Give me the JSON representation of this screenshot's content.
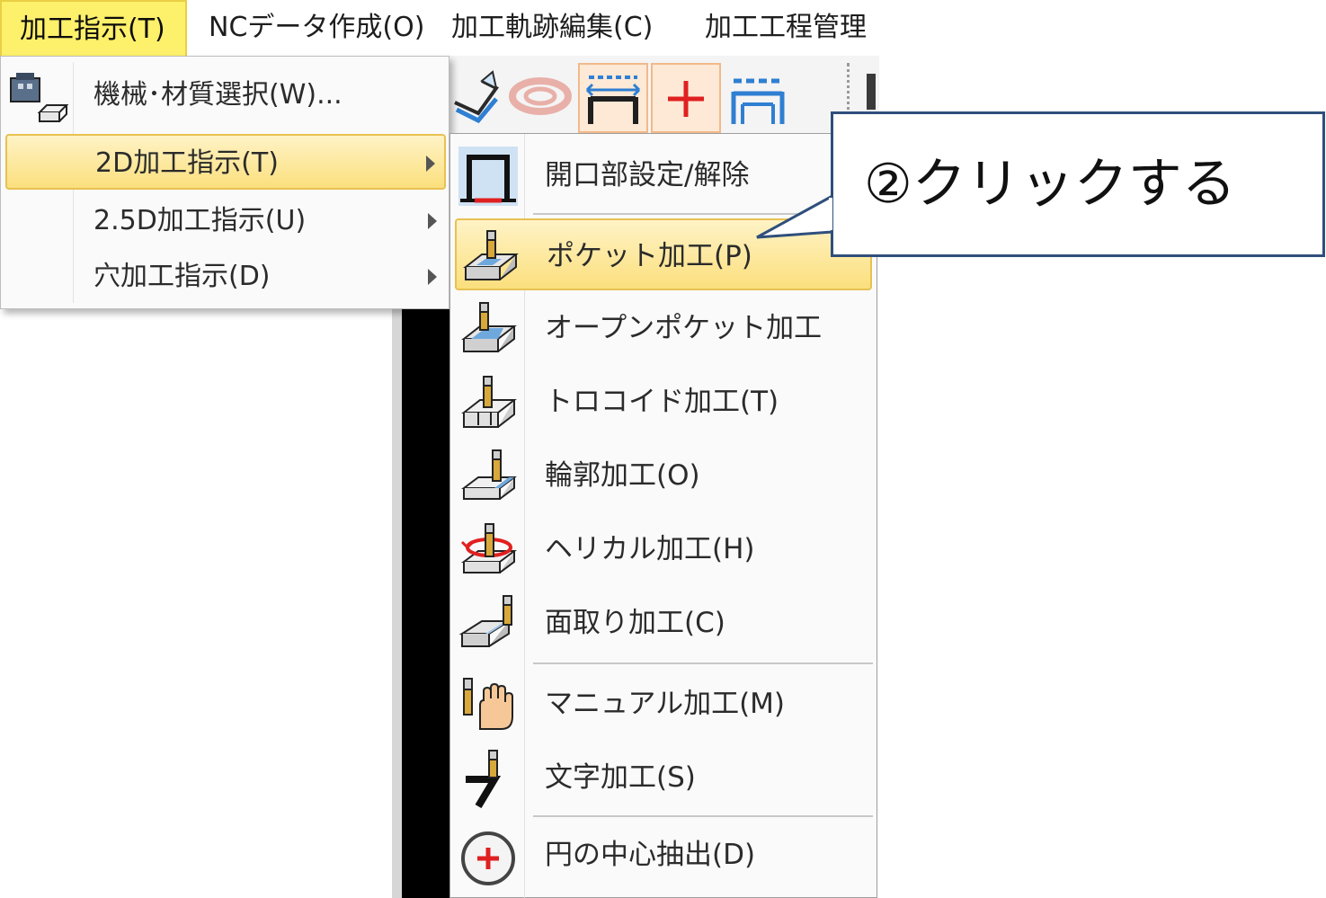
{
  "menubar": {
    "items": [
      {
        "label": "加工指示(T)",
        "active": true
      },
      {
        "label": "NCデータ作成(O)",
        "active": false
      },
      {
        "label": "加工軌跡編集(C)",
        "active": false
      },
      {
        "label": "加工工程管理",
        "active": false
      }
    ]
  },
  "toolbar": {
    "icons": [
      "tilted-layers-icon",
      "link-ring-icon",
      "width-bracket-icon",
      "add-cross-icon",
      "multi-bracket-icon"
    ]
  },
  "menu1": {
    "items": [
      {
        "label": "機械･材質選択(W)...",
        "submenu": false,
        "icon": "machine-material-icon"
      },
      {
        "label": "2D加工指示(T)",
        "submenu": true,
        "highlighted": true
      },
      {
        "label": "2.5D加工指示(U)",
        "submenu": true
      },
      {
        "label": "穴加工指示(D)",
        "submenu": true
      }
    ]
  },
  "menu2": {
    "items": [
      {
        "label": "開口部設定/解除",
        "icon": "opening-icon"
      },
      {
        "label": "ポケット加工(P)",
        "icon": "pocket-icon",
        "highlighted": true
      },
      {
        "label": "オープンポケット加工",
        "icon": "open-pocket-icon"
      },
      {
        "label": "トロコイド加工(T)",
        "icon": "trochoid-icon"
      },
      {
        "label": "輪郭加工(O)",
        "icon": "contour-icon"
      },
      {
        "label": "ヘリカル加工(H)",
        "icon": "helical-icon"
      },
      {
        "label": "面取り加工(C)",
        "icon": "chamfer-icon"
      },
      {
        "label": "マニュアル加工(M)",
        "icon": "manual-icon"
      },
      {
        "label": "文字加工(S)",
        "icon": "text-engrave-icon"
      },
      {
        "label": "円の中心抽出(D)",
        "icon": "circle-center-icon"
      }
    ]
  },
  "callout": {
    "text": "②クリックする"
  },
  "colors": {
    "menu_highlight": "#fbdf7d",
    "menubar_active": "#fdf06a",
    "callout_border": "#2f4f7c",
    "accent_red": "#e02020",
    "accent_blue": "#2f7fd2"
  }
}
